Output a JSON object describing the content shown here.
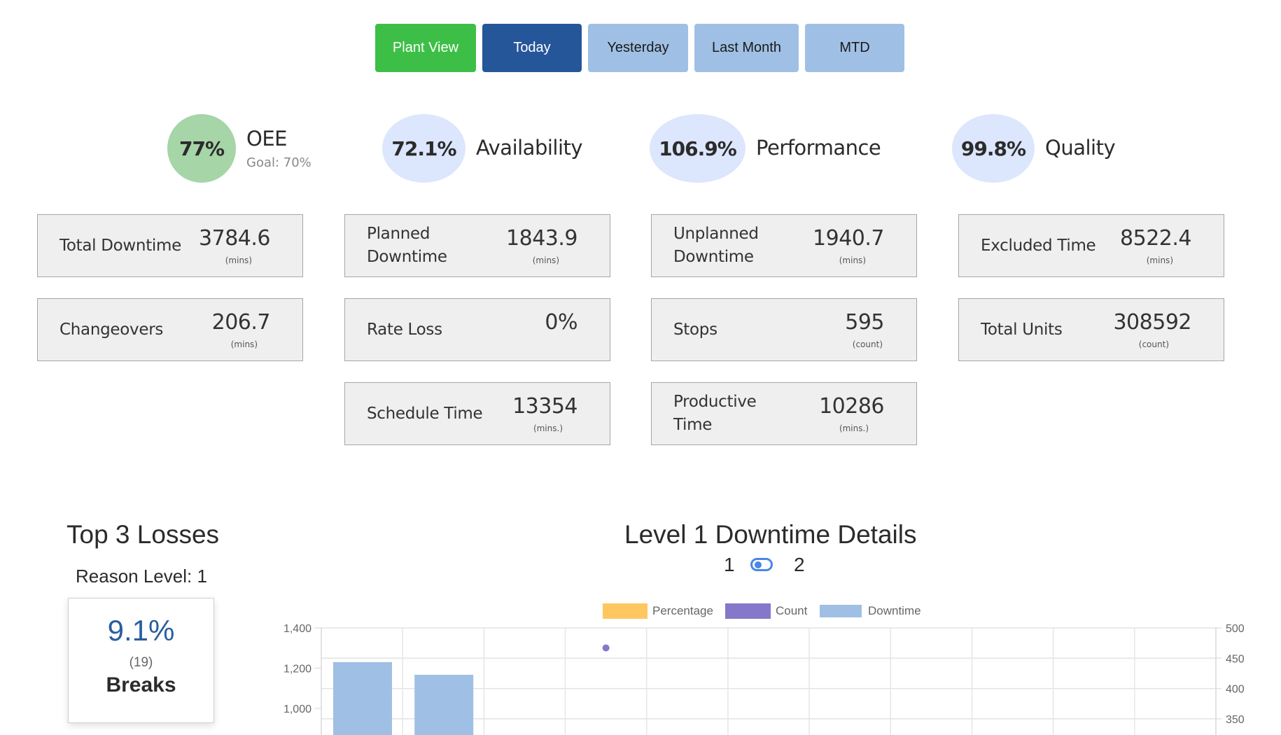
{
  "toolbar": {
    "buttons": [
      {
        "label": "Plant View",
        "style": "green"
      },
      {
        "label": "Today",
        "style": "active"
      },
      {
        "label": "Yesterday",
        "style": "light"
      },
      {
        "label": "Last Month",
        "style": "light"
      },
      {
        "label": "MTD",
        "style": "light"
      }
    ]
  },
  "kpis": {
    "oee": {
      "value": "77%",
      "label": "OEE",
      "goal": "Goal: 70%",
      "color": "#a6d5a8"
    },
    "availability": {
      "value": "72.1%",
      "label": "Availability",
      "color": "#dce6fd"
    },
    "performance": {
      "value": "106.9%",
      "label": "Performance",
      "color": "#dce6fd"
    },
    "quality": {
      "value": "99.8%",
      "label": "Quality",
      "color": "#dce6fd"
    }
  },
  "cards": {
    "total_downtime": {
      "label": "Total Downtime",
      "value": "3784.6",
      "unit": "(mins)"
    },
    "planned_downtime": {
      "label": "Planned Downtime",
      "value": "1843.9",
      "unit": "(mins)"
    },
    "unplanned_downtime": {
      "label": "Unplanned Downtime",
      "value": "1940.7",
      "unit": "(mins)"
    },
    "excluded_time": {
      "label": "Excluded Time",
      "value": "8522.4",
      "unit": "(mins)"
    },
    "changeovers": {
      "label": "Changeovers",
      "value": "206.7",
      "unit": "(mins)"
    },
    "rate_loss": {
      "label": "Rate Loss",
      "value": "0%",
      "unit": ""
    },
    "stops": {
      "label": "Stops",
      "value": "595",
      "unit": "(count)"
    },
    "total_units": {
      "label": "Total Units",
      "value": "308592",
      "unit": "(count)"
    },
    "schedule_time": {
      "label": "Schedule Time",
      "value": "13354",
      "unit": "(mins.)"
    },
    "productive_time": {
      "label": "Productive Time",
      "value": "10286",
      "unit": "(mins.)"
    }
  },
  "losses": {
    "title": "Top 3 Losses",
    "reason_level": "Reason Level: 1",
    "items": [
      {
        "percent": "9.1%",
        "count": "(19)",
        "name": "Breaks"
      }
    ]
  },
  "downtime_details": {
    "title": "Level 1 Downtime Details",
    "toggle_left": "1",
    "toggle_right": "2"
  },
  "chart_data": {
    "type": "bar",
    "title": "Level 1 Downtime Details",
    "legend": [
      "Percentage",
      "Count",
      "Downtime"
    ],
    "legend_colors": {
      "Percentage": "#ffc75f",
      "Count": "#8577c9",
      "Downtime": "#9fc0e4"
    },
    "legend_position": "top-center",
    "category_count": 11,
    "grid": true,
    "y_left": {
      "ticks": [
        "1,400",
        "1,200",
        "1,000"
      ],
      "visible_range": [
        950,
        1400
      ]
    },
    "y_right": {
      "ticks": [
        "500",
        "450",
        "400",
        "350"
      ],
      "visible_range": [
        330,
        500
      ]
    },
    "series": [
      {
        "name": "Downtime",
        "type": "bar",
        "axis": "left",
        "values": [
          1230,
          1167,
          null,
          null,
          null,
          null,
          null,
          null,
          null,
          null,
          null
        ]
      },
      {
        "name": "Count",
        "type": "point",
        "axis": "right",
        "values": [
          null,
          null,
          null,
          467,
          null,
          null,
          null,
          null,
          null,
          null,
          null
        ]
      }
    ]
  }
}
